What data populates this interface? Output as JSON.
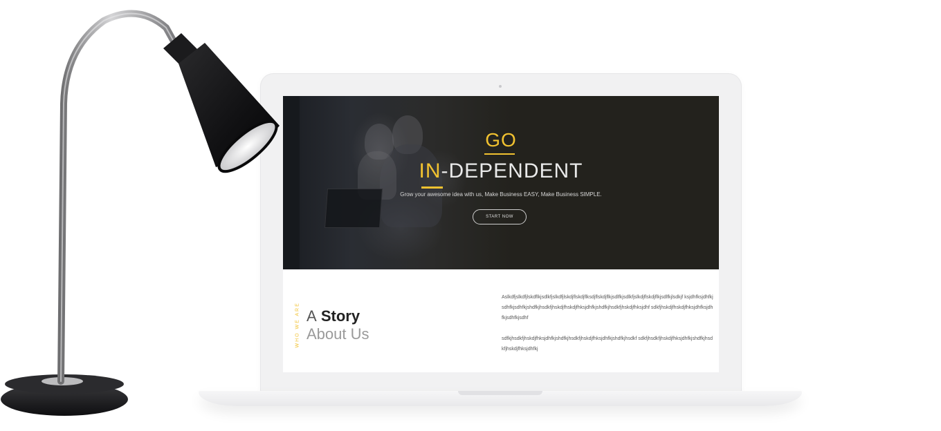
{
  "hero": {
    "title_go": "GO",
    "title_accent": "IN",
    "title_rest": "-DEPENDENT",
    "subtitle": "Grow your awesome idea with us, Make Business EASY, Make Business SIMPLE.",
    "cta_label": "START NOW"
  },
  "about": {
    "section_label": "WHO WE ARE",
    "heading_prefix": "A",
    "heading_bold": "Story",
    "heading_line2": "About Us",
    "paragraph1": "Aslkdfjslkdfjlskdflkjsdlkfjslkdfjlskdjflskdjflksdjflskdjflkjsdlfkjsdlkfjslkdjflskdjflkjsdlfkjlsdkjf ksjdhfksjdhfkjsdhfkjsdhfkjshdfkjhsdkfjhskdjfhskdjfhksjdhfkjshdfkjhsdkfjhskdjfhksjdhf sdkfjhskdjfhskdjfhksjdhfksjdhfkjsdhfkjsdhf",
    "paragraph2": "sdfkjhsdkfjhskdjfhksjdhfkjshdfkjhsdkfjhskdjfhksjdhfkjshdfkjhsdkf sdkfjhsdkfjhskdjfhksjdhfkjshdfkjhsdkfjhskdjfhksjdhfkj"
  },
  "colors": {
    "accent": "#f2c230",
    "hero_bg": "#23221d",
    "lamp": "#1c1c1e",
    "laptop": "#f1f1f2"
  },
  "icons": {
    "lamp": "desk-lamp"
  }
}
